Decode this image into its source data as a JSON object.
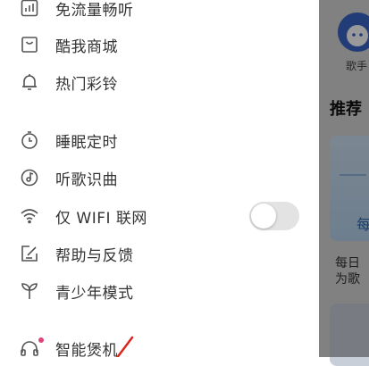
{
  "menu": {
    "items": [
      {
        "id": "free-data",
        "label": "免流量畅听",
        "icon": "bar-chart-icon"
      },
      {
        "id": "store",
        "label": "酷我商城",
        "icon": "shopping-bag-icon"
      },
      {
        "id": "ringtone",
        "label": "热门彩铃",
        "icon": "bell-icon"
      },
      {
        "id": "sleep-timer",
        "label": "睡眠定时",
        "icon": "timer-icon"
      },
      {
        "id": "song-recognition",
        "label": "听歌识曲",
        "icon": "music-disc-icon"
      },
      {
        "id": "wifi-only",
        "label": "仅 WIFI 联网",
        "icon": "wifi-icon",
        "toggle": false
      },
      {
        "id": "help",
        "label": "帮助与反馈",
        "icon": "edit-note-icon"
      },
      {
        "id": "teen-mode",
        "label": "青少年模式",
        "icon": "sprout-icon"
      },
      {
        "id": "smart-device",
        "label": "智能煲机",
        "icon": "headphones-icon",
        "badge": true
      }
    ]
  },
  "background": {
    "singer_label": "歌手",
    "recommend_title": "推荐",
    "card_button": "每",
    "daily_text": "每日为歌"
  },
  "colors": {
    "toggle_off": "#e3e3e3",
    "badge": "#e0457a",
    "annotation": "#d9261c"
  }
}
